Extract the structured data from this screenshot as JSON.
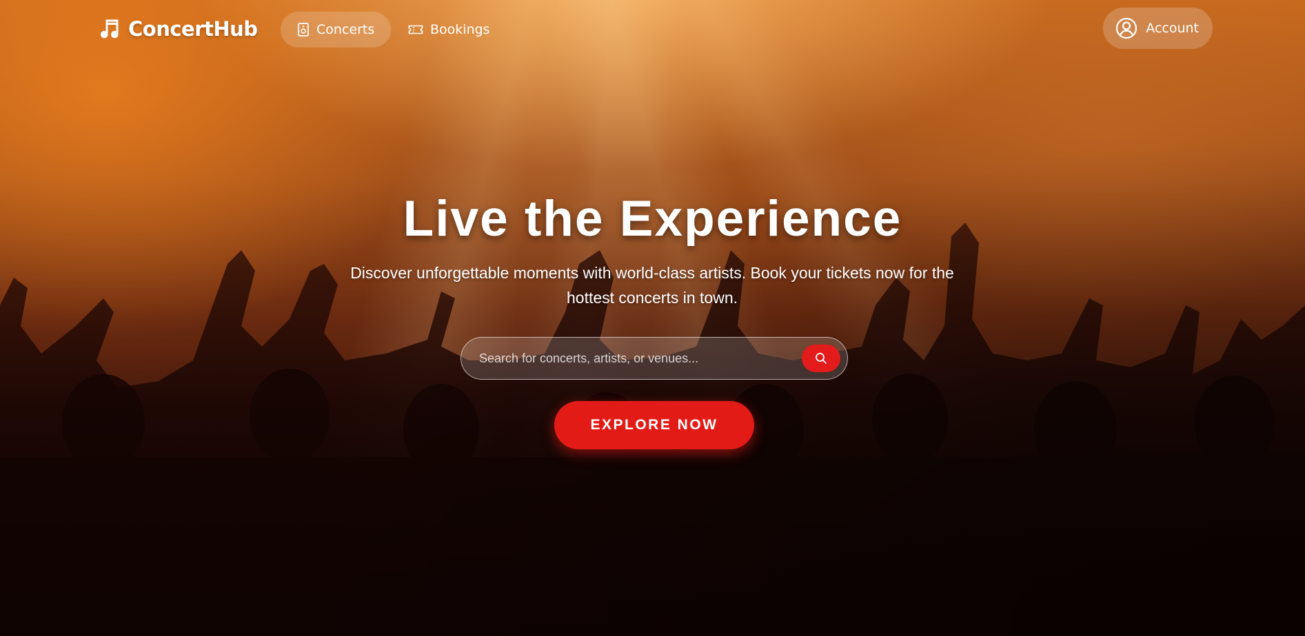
{
  "nav": {
    "brand": "ConcertHub",
    "links": [
      {
        "label": "Concerts",
        "icon": "speaker-icon",
        "active": true
      },
      {
        "label": "Bookings",
        "icon": "ticket-icon",
        "active": false
      }
    ],
    "account_label": "Account"
  },
  "hero": {
    "title": "Live the Experience",
    "subtitle": "Discover unforgettable moments with world-class artists. Book your tickets now for the hottest concerts in town.",
    "search_placeholder": "Search for concerts, artists, or venues...",
    "search_value": "",
    "cta_label": "EXPLORE NOW"
  },
  "colors": {
    "accent": "#e31b16",
    "text": "#ffffff"
  }
}
